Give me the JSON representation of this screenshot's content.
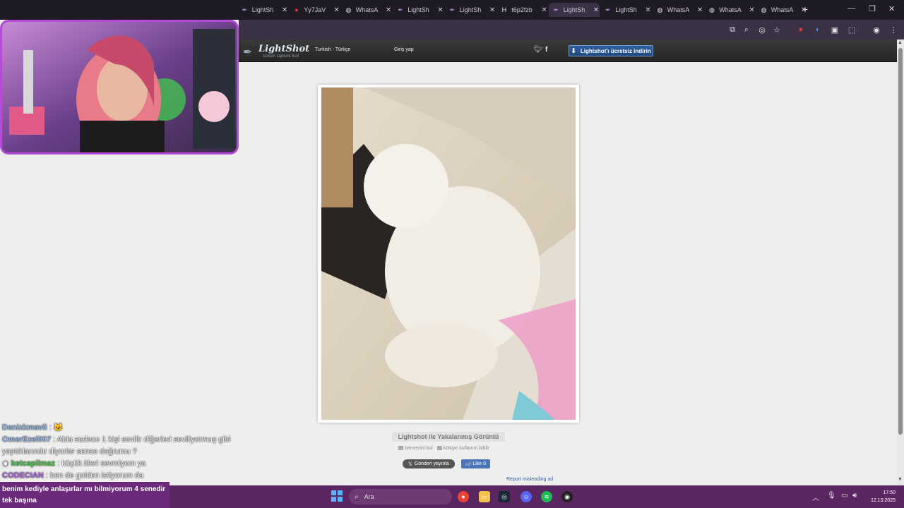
{
  "browser": {
    "tabs": [
      {
        "title": "LightSh",
        "icon": "lightshot-feather-icon",
        "active": false
      },
      {
        "title": "Yy7JaV",
        "icon": "red-drop-icon",
        "active": false
      },
      {
        "title": "WhatsA",
        "icon": "globe-icon",
        "active": false
      },
      {
        "title": "LightSh",
        "icon": "lightshot-feather-icon",
        "active": false
      },
      {
        "title": "LightSh",
        "icon": "lightshot-feather-icon",
        "active": false
      },
      {
        "title": "t6p2fzb",
        "icon": "h-letter-icon",
        "active": false
      },
      {
        "title": "LightSh",
        "icon": "lightshot-feather-icon",
        "active": true
      },
      {
        "title": "LightSh",
        "icon": "lightshot-feather-icon",
        "active": false
      },
      {
        "title": "WhatsA",
        "icon": "globe-icon",
        "active": false
      },
      {
        "title": "WhatsA",
        "icon": "globe-icon",
        "active": false
      },
      {
        "title": "WhatsA",
        "icon": "globe-icon",
        "active": false
      }
    ],
    "accent": "#3a3144"
  },
  "lightshot": {
    "logo_name": "LightShot",
    "logo_tagline": "screen capture tool",
    "language": "Turkish - Türkçe",
    "login": "Giriş yap",
    "download_label": "Lightshot'ı ücretsiz indirin",
    "caption": "Lightshot ile Yakalanmış Görüntü",
    "find_similar": "benzerini bul",
    "report_abuse": "kötüye kullanım bildir",
    "post_label": "Gönderi yayınla",
    "like_label": "Like 0",
    "report_ad": "Report misleading ad"
  },
  "chat": [
    {
      "user": "Denizkmavii",
      "user_color": "#9ab8e6",
      "text": ":"
    },
    {
      "user": "OmerEzel007",
      "user_color": "#9ab8e6",
      "text": ": Abla sadece 1 kişi sevilir diğerleri seviliyormuş gibi yaptıklarındır diyorlar sence doğrumu ?"
    },
    {
      "user": "ketcapilmaz",
      "user_color": "#4ec94e",
      "text": ": küçük itleri sevmiyom ya"
    },
    {
      "user": "CODECIAN",
      "user_color": "#b06adf",
      "text": ": ben de golden istiyorum da"
    }
  ],
  "banner_text": "benim kediyle anlaşırlar mı bilmiyorum 4 senedir tek başına",
  "taskbar": {
    "search_placeholder": "Ara",
    "time": "17:50",
    "date": "12.10.2025"
  }
}
